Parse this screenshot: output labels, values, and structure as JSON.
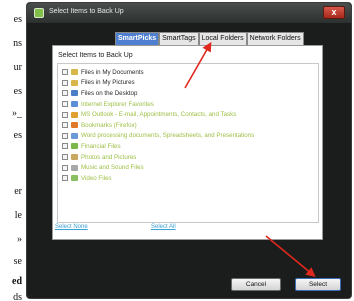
{
  "background_text": [
    {
      "text": "es",
      "bold": false
    },
    {
      "text": "ns",
      "bold": false
    },
    {
      "text": "ur",
      "bold": false
    },
    {
      "text": "es",
      "bold": false
    },
    {
      "text": "»_",
      "bold": false
    },
    {
      "text": "es",
      "bold": false
    },
    {
      "text": "er",
      "bold": false
    },
    {
      "text": "le",
      "bold": false
    },
    {
      "text": "»",
      "bold": false
    },
    {
      "text": "se",
      "bold": false
    },
    {
      "text": "ed",
      "bold": true
    },
    {
      "text": "ds",
      "bold": false
    }
  ],
  "window": {
    "title": "Select Items to Back Up",
    "close_glyph": "x"
  },
  "tabs": [
    {
      "label": "SmartPicks",
      "active": true
    },
    {
      "label": "SmartTags",
      "active": false
    },
    {
      "label": "Local Folders",
      "active": false
    },
    {
      "label": "Network Folders",
      "active": false
    }
  ],
  "panel": {
    "title": "Select Items to Back Up",
    "items": [
      {
        "label": "Files in My Documents",
        "icon": "folder-icon",
        "icon_color": "#d9b54a",
        "enabled": true
      },
      {
        "label": "Files in My Pictures",
        "icon": "folder-icon",
        "icon_color": "#d9b54a",
        "enabled": true
      },
      {
        "label": "Files on the Desktop",
        "icon": "desktop-icon",
        "icon_color": "#4a7fc8",
        "enabled": true
      },
      {
        "label": "Internet Explorer Favorites",
        "icon": "ie-icon",
        "icon_color": "#5a8fd8",
        "enabled": false
      },
      {
        "label": "MS Outlook - E-mail, Appointments, Contacts, and Tasks",
        "icon": "outlook-icon",
        "icon_color": "#e0a030",
        "enabled": false
      },
      {
        "label": "Bookmarks (Firefox)",
        "icon": "firefox-icon",
        "icon_color": "#e07a2a",
        "enabled": false
      },
      {
        "label": "Word processing documents, Spreadsheets, and Presentations",
        "icon": "document-icon",
        "icon_color": "#6a9ad8",
        "enabled": false
      },
      {
        "label": "Financial Files",
        "icon": "money-icon",
        "icon_color": "#7ab84a",
        "enabled": false
      },
      {
        "label": "Photos and Pictures",
        "icon": "photo-icon",
        "icon_color": "#c8a860",
        "enabled": false
      },
      {
        "label": "Music and Sound Files",
        "icon": "music-icon",
        "icon_color": "#a8a8a8",
        "enabled": false
      },
      {
        "label": "Video Files",
        "icon": "video-icon",
        "icon_color": "#8ac060",
        "enabled": false
      }
    ],
    "select_none": "Select None",
    "select_all": "Select All"
  },
  "buttons": {
    "cancel": "Cancel",
    "select": "Select"
  },
  "colors": {
    "annotation_arrow": "#e0281e",
    "dialog_bg": "#1b1d1c",
    "active_tab": "#4f7fd0",
    "link": "#3aa0d8",
    "disabled_label": "#9cbf45"
  }
}
